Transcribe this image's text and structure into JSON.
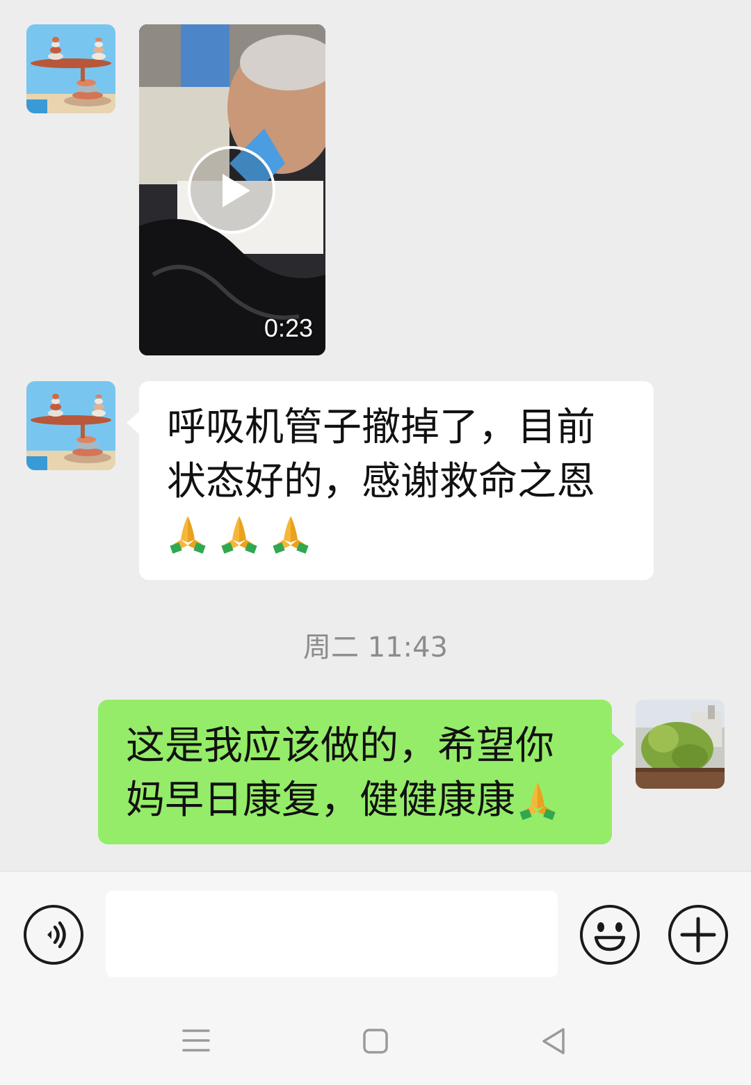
{
  "messages": [
    {
      "type": "video",
      "sender": "other",
      "duration": "0:23"
    },
    {
      "type": "text",
      "sender": "other",
      "text": "呼吸机管子撤掉了，目前\n状态好的，感谢救命之恩",
      "emoji": [
        "🙏",
        "🙏",
        "🙏"
      ]
    },
    {
      "type": "timestamp",
      "text": "周二 11:43"
    },
    {
      "type": "text",
      "sender": "self",
      "text": "这是我应该做的，希望你\n妈早日康复，健健康康",
      "emoji": [
        "🙏"
      ]
    }
  ],
  "input_bar": {
    "voice_icon": "voice-icon",
    "emoji_icon": "smiley-icon",
    "plus_icon": "plus-icon",
    "input_value": ""
  },
  "nav_bar": {
    "menu_icon": "menu-icon",
    "home_icon": "home-square-icon",
    "back_icon": "back-triangle-icon"
  },
  "colors": {
    "chat_background": "#ededed",
    "incoming_bubble": "#ffffff",
    "outgoing_bubble": "#95ec69",
    "timestamp_text": "#8c8c8c"
  }
}
